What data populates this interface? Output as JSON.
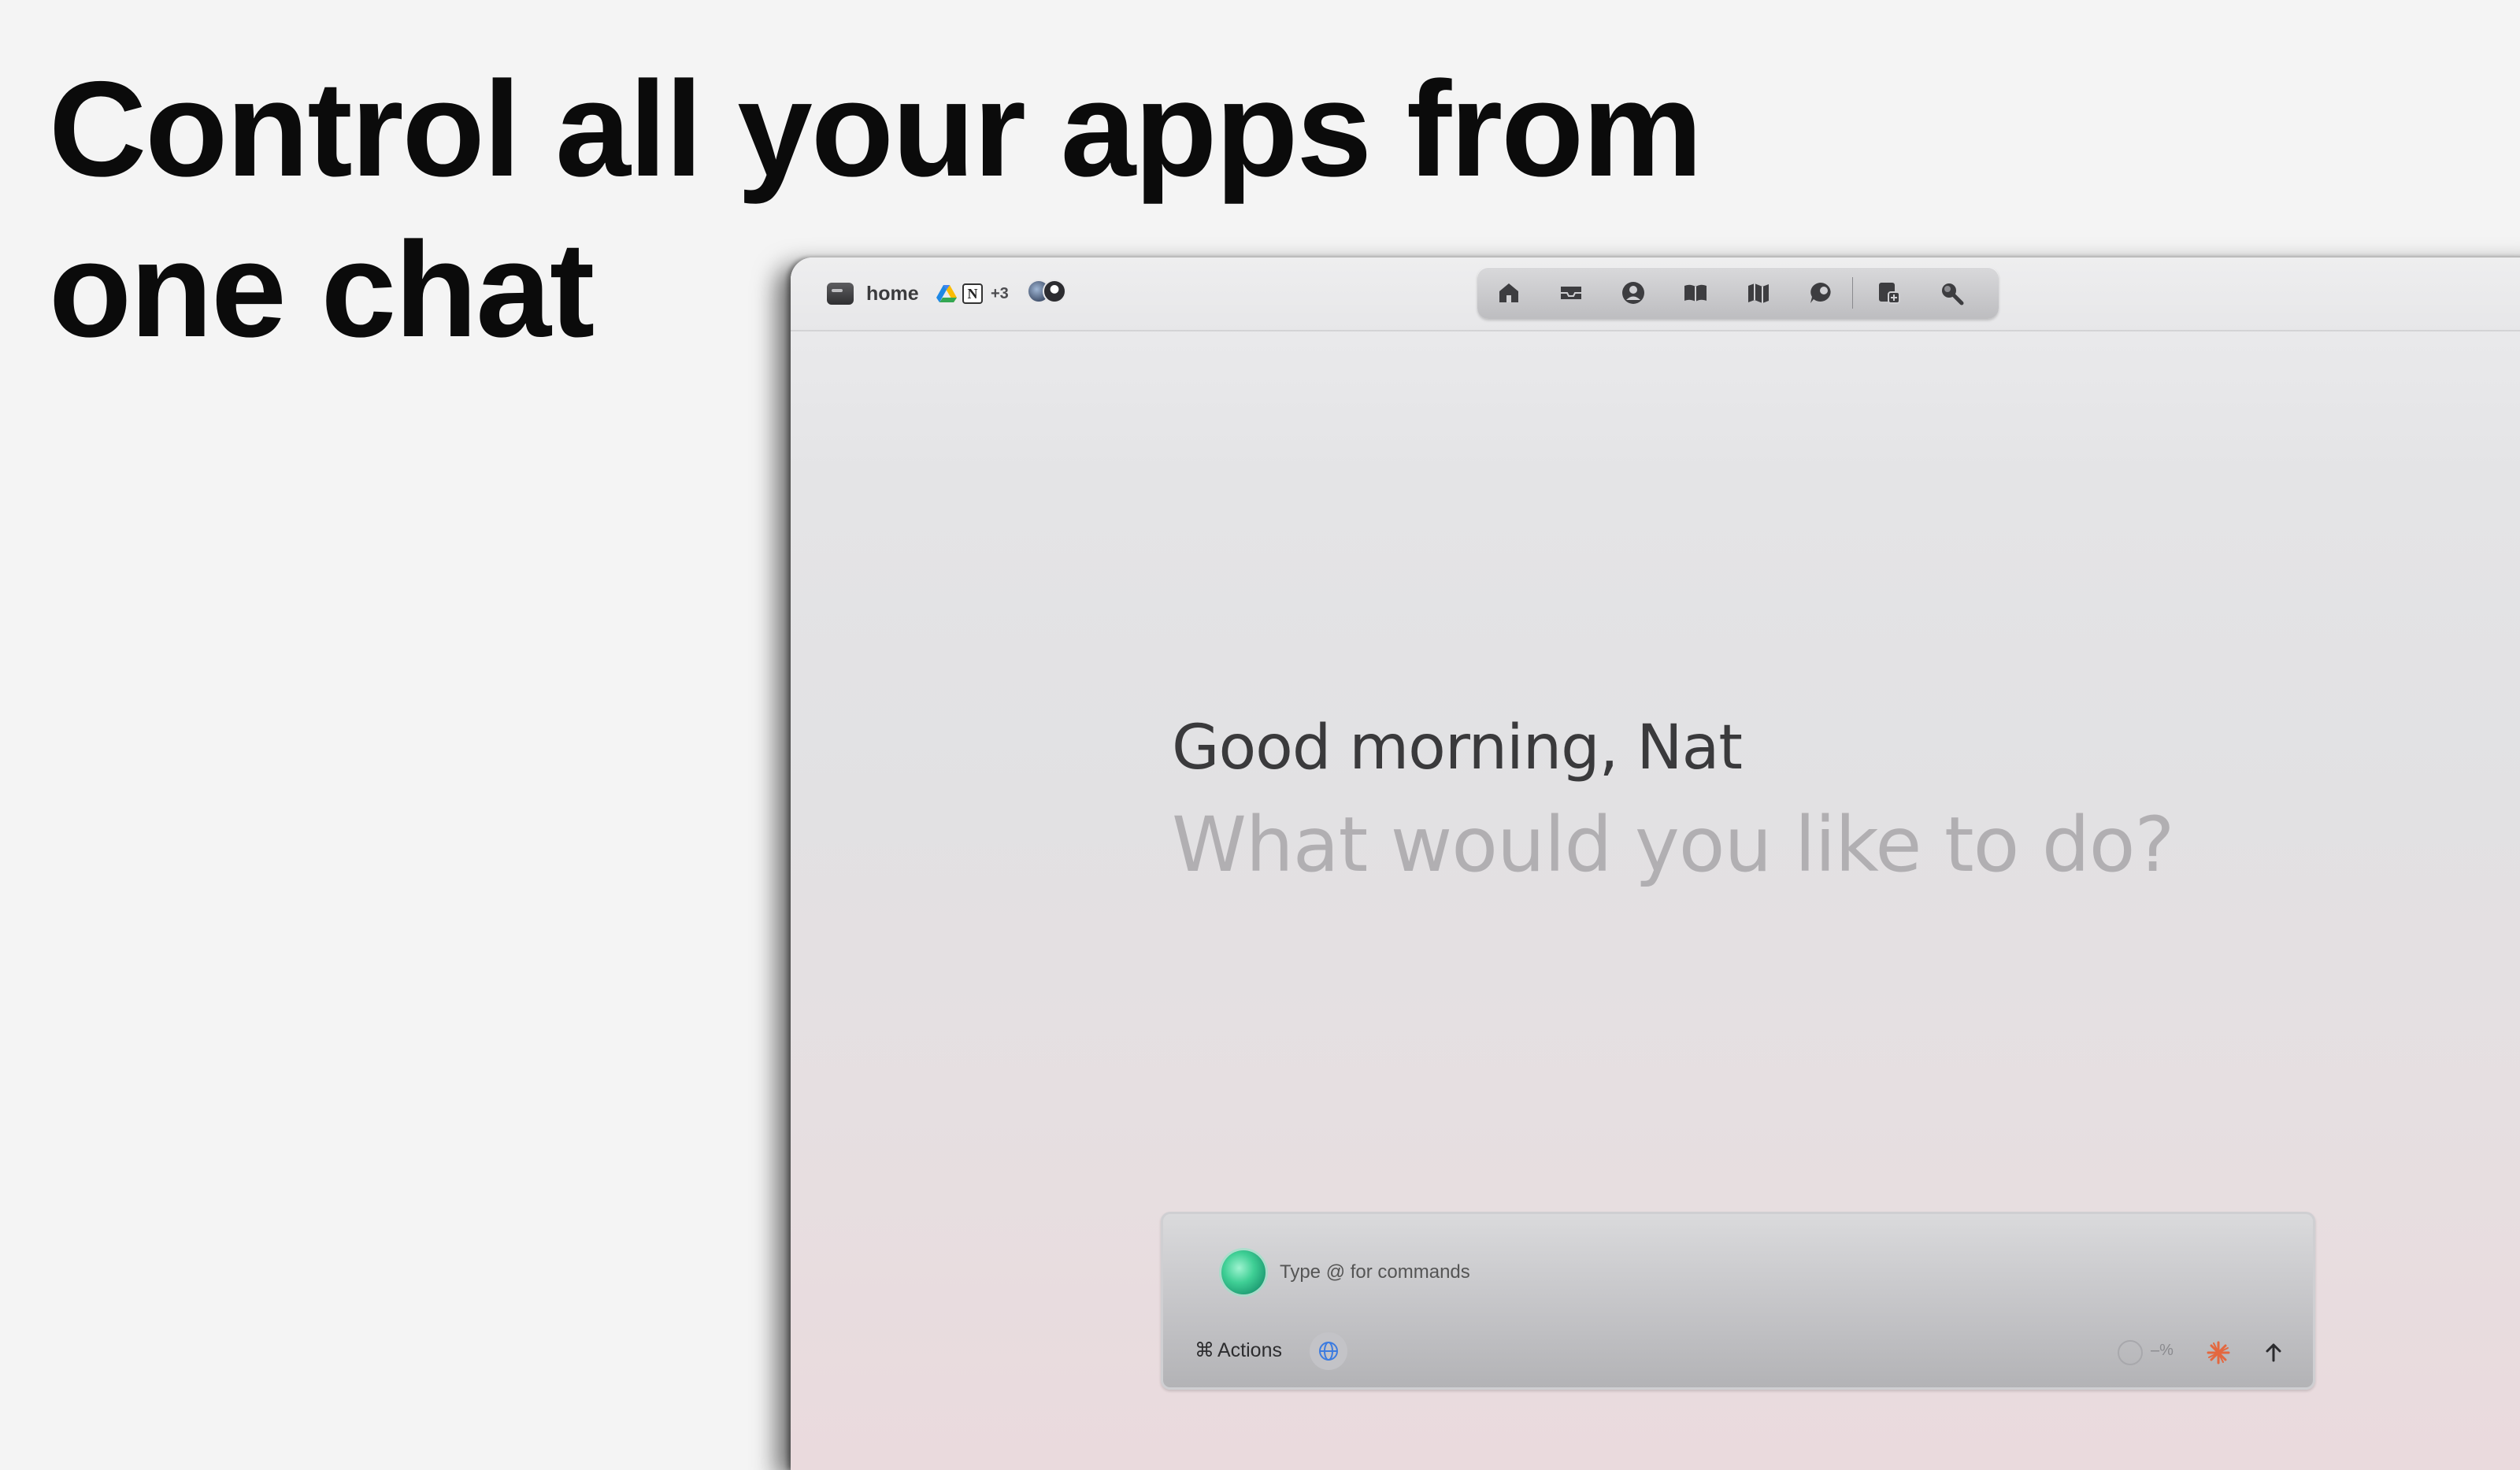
{
  "headline": "Control all your apps from one chat",
  "window": {
    "tab": {
      "label": "home",
      "icon": "window-icon"
    },
    "integrations": {
      "icons": [
        "google-drive-icon",
        "notion-icon"
      ],
      "notion_letter": "N",
      "more_count": "+3"
    },
    "avatars": [
      "user-avatar",
      "user-avatar"
    ],
    "nav": {
      "items": [
        "home-icon",
        "inbox-icon",
        "profile-icon",
        "book-icon",
        "map-icon",
        "chat-bubble-icon",
        "new-page-icon",
        "search-icon"
      ]
    }
  },
  "main": {
    "greeting": "Good morning, Nat",
    "subprompt": "What would you like to do?"
  },
  "composer": {
    "placeholder": "Type @ for commands",
    "actions_symbol": "⌘",
    "actions_label": "Actions",
    "percent_text": "–%",
    "accent_color": "#3fcf95",
    "spark_color": "#e4683f"
  }
}
